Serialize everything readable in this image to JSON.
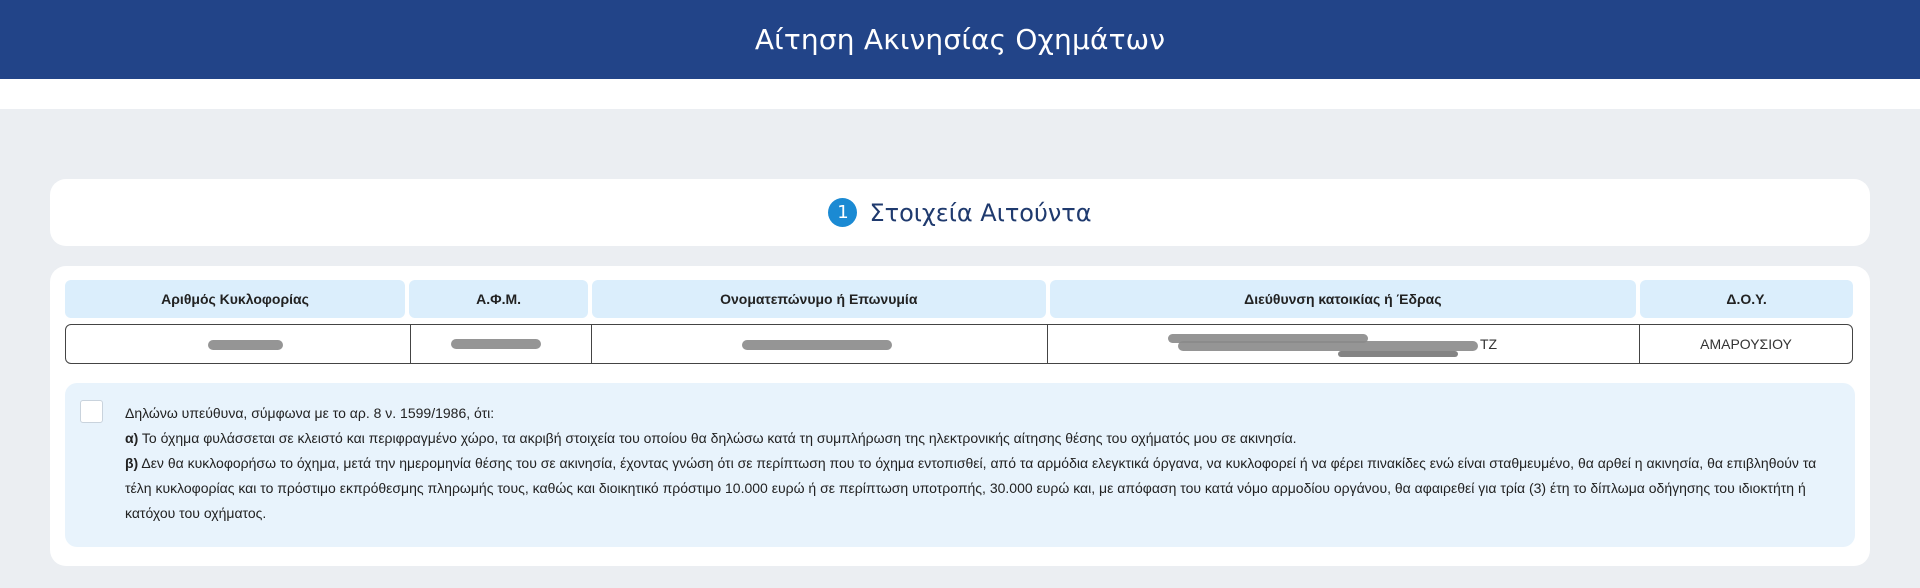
{
  "header": {
    "title": "Αίτηση Ακινησίας Οχημάτων"
  },
  "step": {
    "number": "1",
    "title": "Στοιχεία Αιτούντα"
  },
  "table": {
    "columns": [
      "Αριθμός Κυκλοφορίας",
      "Α.Φ.Μ.",
      "Ονοματεπώνυμο ή Επωνυμία",
      "Διεύθυνση κατοικίας ή Έδρας",
      "Δ.Ο.Υ."
    ],
    "row": {
      "plate": "",
      "afm": "",
      "name": "",
      "address_tail": "ΤΖ",
      "doy": "ΑΜΑΡΟΥΣΙΟΥ"
    }
  },
  "declaration": {
    "checked": false,
    "intro": "Δηλώνω υπεύθυνα, σύμφωνα με το αρ. 8 ν. 1599/1986, ότι:",
    "a_label": "α)",
    "a_text": " Το όχημα φυλάσσεται σε κλειστό και περιφραγμένο χώρο, τα ακριβή στοιχεία του οποίου θα δηλώσω κατά τη συμπλήρωση της ηλεκτρονικής αίτησης θέσης του οχήματός μου σε ακινησία.",
    "b_label": "β)",
    "b_text": " Δεν θα κυκλοφορήσω το όχημα, μετά την ημερομηνία θέσης του σε ακινησία, έχοντας γνώση ότι σε περίπτωση που το όχημα εντοπισθεί, από τα αρμόδια ελεγκτικά όργανα, να κυκλοφορεί ή να φέρει πινακίδες ενώ είναι σταθμευμένο, θα αρθεί η ακινησία, θα επιβληθούν τα τέλη κυκλοφορίας και το πρόστιμο εκπρόθεσμης πληρωμής τους, καθώς και διοικητικό πρόστιμο 10.000 ευρώ ή σε περίπτωση υποτροπής, 30.000 ευρώ και, με απόφαση του κατά νόμο αρμοδίου οργάνου, θα αφαιρεθεί για τρία (3) έτη το δίπλωμα οδήγησης του ιδιοκτήτη ή κατόχου του οχήματος."
  }
}
